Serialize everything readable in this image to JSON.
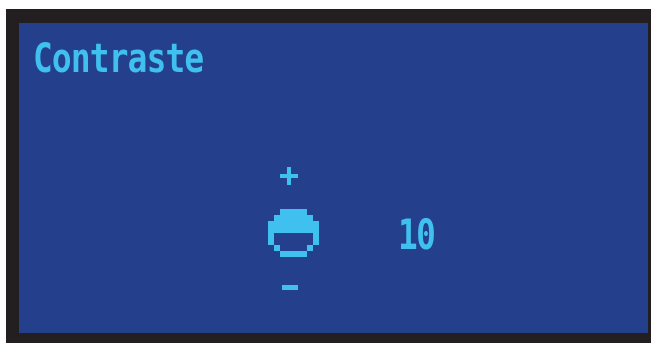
{
  "screen": {
    "title": "Contraste",
    "value": "10"
  },
  "controls": {
    "increase_symbol": "+",
    "decrease_symbol": "-",
    "icon": "contrast-knob-icon"
  },
  "colors": {
    "background": "#243f8c",
    "foreground": "#3fc0ee",
    "frame": "#231f20"
  }
}
